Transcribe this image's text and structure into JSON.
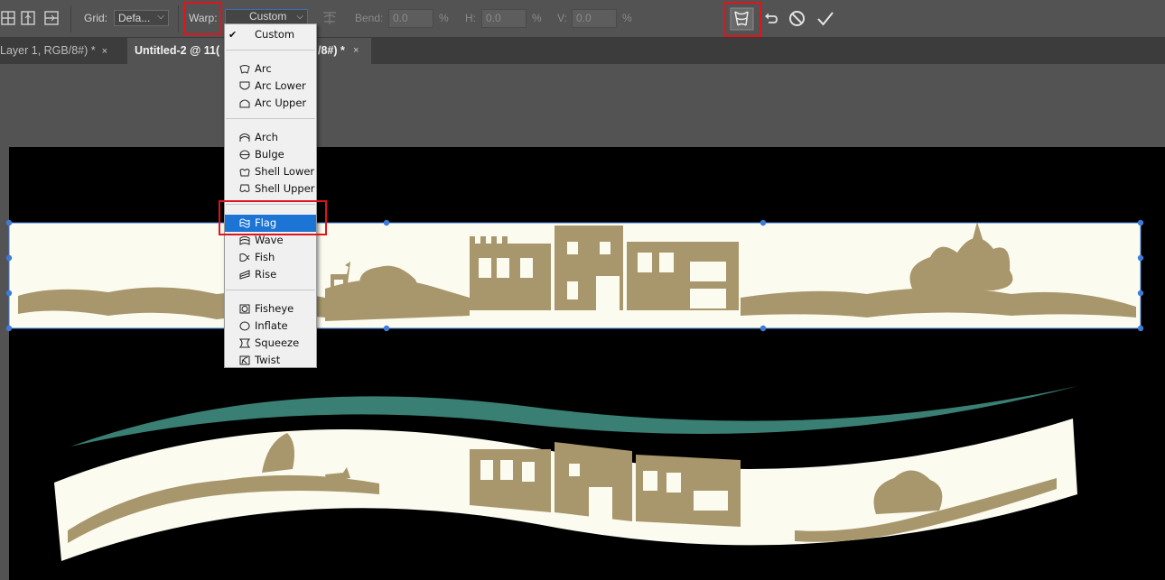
{
  "options_bar": {
    "grid_label": "Grid:",
    "grid_value": "Defa...",
    "warp_label": "Warp:",
    "warp_value": "Custom",
    "bend_label": "Bend:",
    "bend_value": "0.0",
    "bend_unit": "%",
    "h_label": "H:",
    "h_value": "0.0",
    "h_unit": "%",
    "v_label": "V:",
    "v_value": "0.0",
    "v_unit": "%",
    "icons": [
      "split-vertical-icon",
      "split-horizontal-icon",
      "split-cross-icon",
      "warp-orientation-icon",
      "warp-mode-toggle-icon",
      "undo-icon",
      "cancel-icon",
      "commit-check-icon"
    ]
  },
  "tabs": [
    {
      "label": "Layer 1, RGB/8#) *",
      "close": "×"
    },
    {
      "label": "Untitled-2 @ 11(",
      "tail": "/8#) *",
      "close": "×"
    }
  ],
  "warp_menu": {
    "checked_item": "Custom",
    "selected_item": "Flag",
    "groups": [
      [
        {
          "label": "Custom",
          "icon": "check-icon"
        }
      ],
      [
        {
          "label": "Arc",
          "icon": "arc-icon"
        },
        {
          "label": "Arc Lower",
          "icon": "arc-lower-icon"
        },
        {
          "label": "Arc Upper",
          "icon": "arc-upper-icon"
        }
      ],
      [
        {
          "label": "Arch",
          "icon": "arch-icon"
        },
        {
          "label": "Bulge",
          "icon": "bulge-icon"
        },
        {
          "label": "Shell Lower",
          "icon": "shell-lower-icon"
        },
        {
          "label": "Shell Upper",
          "icon": "shell-upper-icon"
        }
      ],
      [
        {
          "label": "Flag",
          "icon": "flag-icon"
        },
        {
          "label": "Wave",
          "icon": "wave-icon"
        },
        {
          "label": "Fish",
          "icon": "fish-icon"
        },
        {
          "label": "Rise",
          "icon": "rise-icon"
        }
      ],
      [
        {
          "label": "Fisheye",
          "icon": "fisheye-icon"
        },
        {
          "label": "Inflate",
          "icon": "inflate-icon"
        },
        {
          "label": "Squeeze",
          "icon": "squeeze-icon"
        },
        {
          "label": "Twist",
          "icon": "twist-icon"
        }
      ]
    ]
  },
  "colors": {
    "highlight": "#e0141b",
    "menu_selection": "#1c74d4",
    "banner_fill": "#fcfbf0",
    "silhouette": "#a8976c",
    "teal_ribbon": "#3a7f73",
    "transform_handle": "#3e7bd8"
  }
}
